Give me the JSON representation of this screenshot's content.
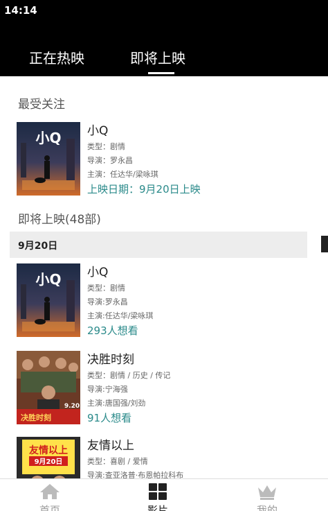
{
  "status": {
    "time": "14:14"
  },
  "tabs": {
    "now_showing": "正在热映",
    "coming_soon": "即将上映"
  },
  "featured": {
    "title": "最受关注",
    "movie": {
      "title": "小Q",
      "genre": "类型：剧情",
      "director": "导演：罗永昌",
      "cast": "主演：任达华/梁咏琪",
      "release": "上映日期：9月20日上映"
    }
  },
  "upcoming": {
    "title": "即将上映(48部)",
    "date": "9月20日",
    "movies": [
      {
        "title": "小Q",
        "genre": "类型：剧情",
        "director": "导演:罗永昌",
        "cast": "主演:任达华/梁咏琪",
        "wants": "293人想看"
      },
      {
        "title": "决胜时刻",
        "genre": "类型：剧情 / 历史 / 传记",
        "director": "导演:宁海强",
        "cast": "主演:唐国强/刘劲",
        "wants": "91人想看"
      },
      {
        "title": "友情以上",
        "genre": "类型：喜剧 / 爱情",
        "director": "导演:查亚洛普·布恩帕拉科布"
      }
    ]
  },
  "posters": {
    "xiaoq_text": "小Q",
    "juesheng_text": "决胜时刻",
    "juesheng_date": "9.20",
    "youqing_title": "友情以上",
    "youqing_date": "9月20日"
  },
  "nav": {
    "home": "首页",
    "movies": "影片",
    "mine": "我的"
  }
}
